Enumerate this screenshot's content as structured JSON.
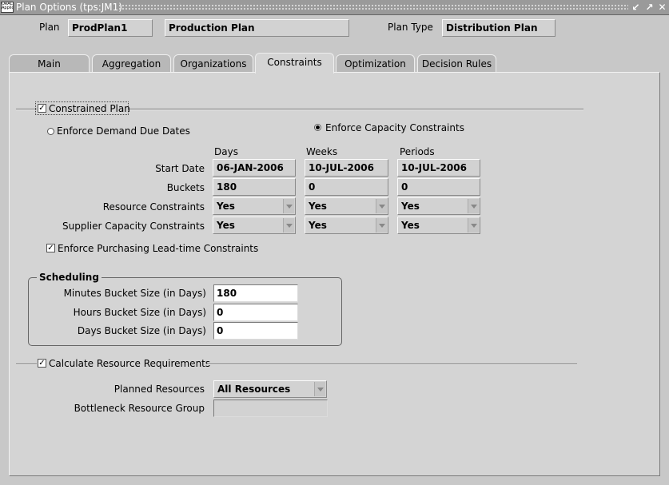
{
  "window": {
    "title": "Plan Options (tps:JM1)",
    "icon_text": "ORACLE Applications",
    "buttons": [
      "minimize",
      "restore",
      "close"
    ]
  },
  "header": {
    "plan_label": "Plan",
    "plan_value": "ProdPlan1",
    "plan_desc": "Production Plan",
    "plan_type_label": "Plan Type",
    "plan_type_value": "Distribution Plan"
  },
  "tabs": [
    {
      "label": "Main",
      "active": false
    },
    {
      "label": "Aggregation",
      "active": false
    },
    {
      "label": "Organizations",
      "active": false
    },
    {
      "label": "Constraints",
      "active": true
    },
    {
      "label": "Optimization",
      "active": false
    },
    {
      "label": "Decision Rules",
      "active": false
    }
  ],
  "constrained": {
    "label": "Constrained Plan",
    "checked": true,
    "radio_demand": "Enforce Demand Due Dates",
    "radio_capacity": "Enforce Capacity Constraints",
    "selected": "capacity"
  },
  "grid": {
    "columns": [
      "Days",
      "Weeks",
      "Periods"
    ],
    "start_date": {
      "label": "Start Date",
      "values": [
        "06-JAN-2006",
        "10-JUL-2006",
        "10-JUL-2006"
      ]
    },
    "buckets": {
      "label": "Buckets",
      "values": [
        "180",
        "0",
        "0"
      ]
    },
    "resource_constraints": {
      "label": "Resource Constraints",
      "values": [
        "Yes",
        "Yes",
        "Yes"
      ]
    },
    "supplier_constraints": {
      "label": "Supplier Capacity Constraints",
      "values": [
        "Yes",
        "Yes",
        "Yes"
      ]
    }
  },
  "purchasing": {
    "label": "Enforce Purchasing Lead-time Constraints",
    "checked": true
  },
  "scheduling": {
    "title": "Scheduling",
    "minutes": {
      "label": "Minutes Bucket Size (in Days)",
      "value": "180"
    },
    "hours": {
      "label": "Hours Bucket Size (in Days)",
      "value": "0"
    },
    "days": {
      "label": "Days Bucket Size (in Days)",
      "value": "0"
    }
  },
  "resource_req": {
    "label": "Calculate Resource Requirements",
    "checked": true,
    "planned_label": "Planned Resources",
    "planned_value": "All Resources",
    "bottleneck_label": "Bottleneck Resource Group",
    "bottleneck_value": ""
  },
  "colors": {
    "title_bar": "#9a9a9a",
    "background": "#c8c8c8",
    "panel": "#d4d4d4"
  }
}
